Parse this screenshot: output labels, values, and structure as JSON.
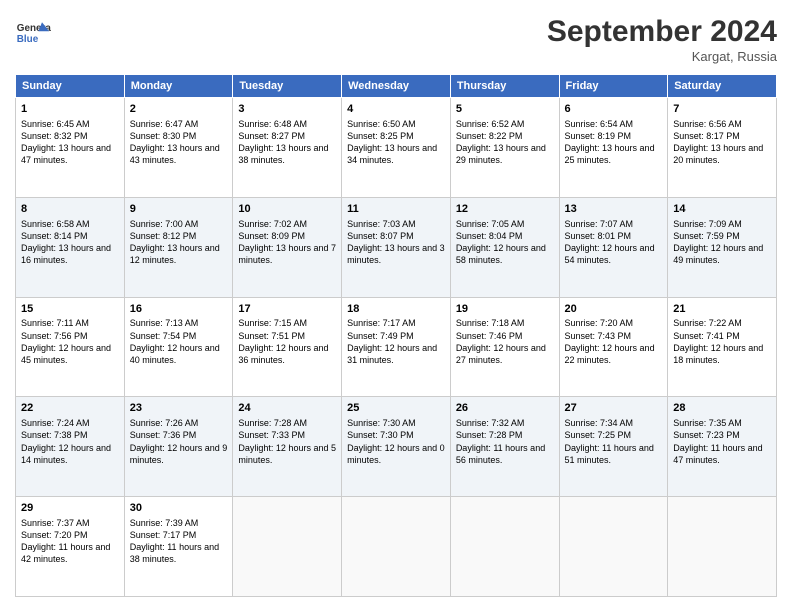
{
  "header": {
    "logo_line1": "General",
    "logo_line2": "Blue",
    "month": "September 2024",
    "location": "Kargat, Russia"
  },
  "days_of_week": [
    "Sunday",
    "Monday",
    "Tuesday",
    "Wednesday",
    "Thursday",
    "Friday",
    "Saturday"
  ],
  "weeks": [
    [
      {
        "day": "1",
        "sunrise": "6:45 AM",
        "sunset": "8:32 PM",
        "daylight": "13 hours and 47 minutes."
      },
      {
        "day": "2",
        "sunrise": "6:47 AM",
        "sunset": "8:30 PM",
        "daylight": "13 hours and 43 minutes."
      },
      {
        "day": "3",
        "sunrise": "6:48 AM",
        "sunset": "8:27 PM",
        "daylight": "13 hours and 38 minutes."
      },
      {
        "day": "4",
        "sunrise": "6:50 AM",
        "sunset": "8:25 PM",
        "daylight": "13 hours and 34 minutes."
      },
      {
        "day": "5",
        "sunrise": "6:52 AM",
        "sunset": "8:22 PM",
        "daylight": "13 hours and 29 minutes."
      },
      {
        "day": "6",
        "sunrise": "6:54 AM",
        "sunset": "8:19 PM",
        "daylight": "13 hours and 25 minutes."
      },
      {
        "day": "7",
        "sunrise": "6:56 AM",
        "sunset": "8:17 PM",
        "daylight": "13 hours and 20 minutes."
      }
    ],
    [
      {
        "day": "8",
        "sunrise": "6:58 AM",
        "sunset": "8:14 PM",
        "daylight": "13 hours and 16 minutes."
      },
      {
        "day": "9",
        "sunrise": "7:00 AM",
        "sunset": "8:12 PM",
        "daylight": "13 hours and 12 minutes."
      },
      {
        "day": "10",
        "sunrise": "7:02 AM",
        "sunset": "8:09 PM",
        "daylight": "13 hours and 7 minutes."
      },
      {
        "day": "11",
        "sunrise": "7:03 AM",
        "sunset": "8:07 PM",
        "daylight": "13 hours and 3 minutes."
      },
      {
        "day": "12",
        "sunrise": "7:05 AM",
        "sunset": "8:04 PM",
        "daylight": "12 hours and 58 minutes."
      },
      {
        "day": "13",
        "sunrise": "7:07 AM",
        "sunset": "8:01 PM",
        "daylight": "12 hours and 54 minutes."
      },
      {
        "day": "14",
        "sunrise": "7:09 AM",
        "sunset": "7:59 PM",
        "daylight": "12 hours and 49 minutes."
      }
    ],
    [
      {
        "day": "15",
        "sunrise": "7:11 AM",
        "sunset": "7:56 PM",
        "daylight": "12 hours and 45 minutes."
      },
      {
        "day": "16",
        "sunrise": "7:13 AM",
        "sunset": "7:54 PM",
        "daylight": "12 hours and 40 minutes."
      },
      {
        "day": "17",
        "sunrise": "7:15 AM",
        "sunset": "7:51 PM",
        "daylight": "12 hours and 36 minutes."
      },
      {
        "day": "18",
        "sunrise": "7:17 AM",
        "sunset": "7:49 PM",
        "daylight": "12 hours and 31 minutes."
      },
      {
        "day": "19",
        "sunrise": "7:18 AM",
        "sunset": "7:46 PM",
        "daylight": "12 hours and 27 minutes."
      },
      {
        "day": "20",
        "sunrise": "7:20 AM",
        "sunset": "7:43 PM",
        "daylight": "12 hours and 22 minutes."
      },
      {
        "day": "21",
        "sunrise": "7:22 AM",
        "sunset": "7:41 PM",
        "daylight": "12 hours and 18 minutes."
      }
    ],
    [
      {
        "day": "22",
        "sunrise": "7:24 AM",
        "sunset": "7:38 PM",
        "daylight": "12 hours and 14 minutes."
      },
      {
        "day": "23",
        "sunrise": "7:26 AM",
        "sunset": "7:36 PM",
        "daylight": "12 hours and 9 minutes."
      },
      {
        "day": "24",
        "sunrise": "7:28 AM",
        "sunset": "7:33 PM",
        "daylight": "12 hours and 5 minutes."
      },
      {
        "day": "25",
        "sunrise": "7:30 AM",
        "sunset": "7:30 PM",
        "daylight": "12 hours and 0 minutes."
      },
      {
        "day": "26",
        "sunrise": "7:32 AM",
        "sunset": "7:28 PM",
        "daylight": "11 hours and 56 minutes."
      },
      {
        "day": "27",
        "sunrise": "7:34 AM",
        "sunset": "7:25 PM",
        "daylight": "11 hours and 51 minutes."
      },
      {
        "day": "28",
        "sunrise": "7:35 AM",
        "sunset": "7:23 PM",
        "daylight": "11 hours and 47 minutes."
      }
    ],
    [
      {
        "day": "29",
        "sunrise": "7:37 AM",
        "sunset": "7:20 PM",
        "daylight": "11 hours and 42 minutes."
      },
      {
        "day": "30",
        "sunrise": "7:39 AM",
        "sunset": "7:17 PM",
        "daylight": "11 hours and 38 minutes."
      },
      null,
      null,
      null,
      null,
      null
    ]
  ]
}
